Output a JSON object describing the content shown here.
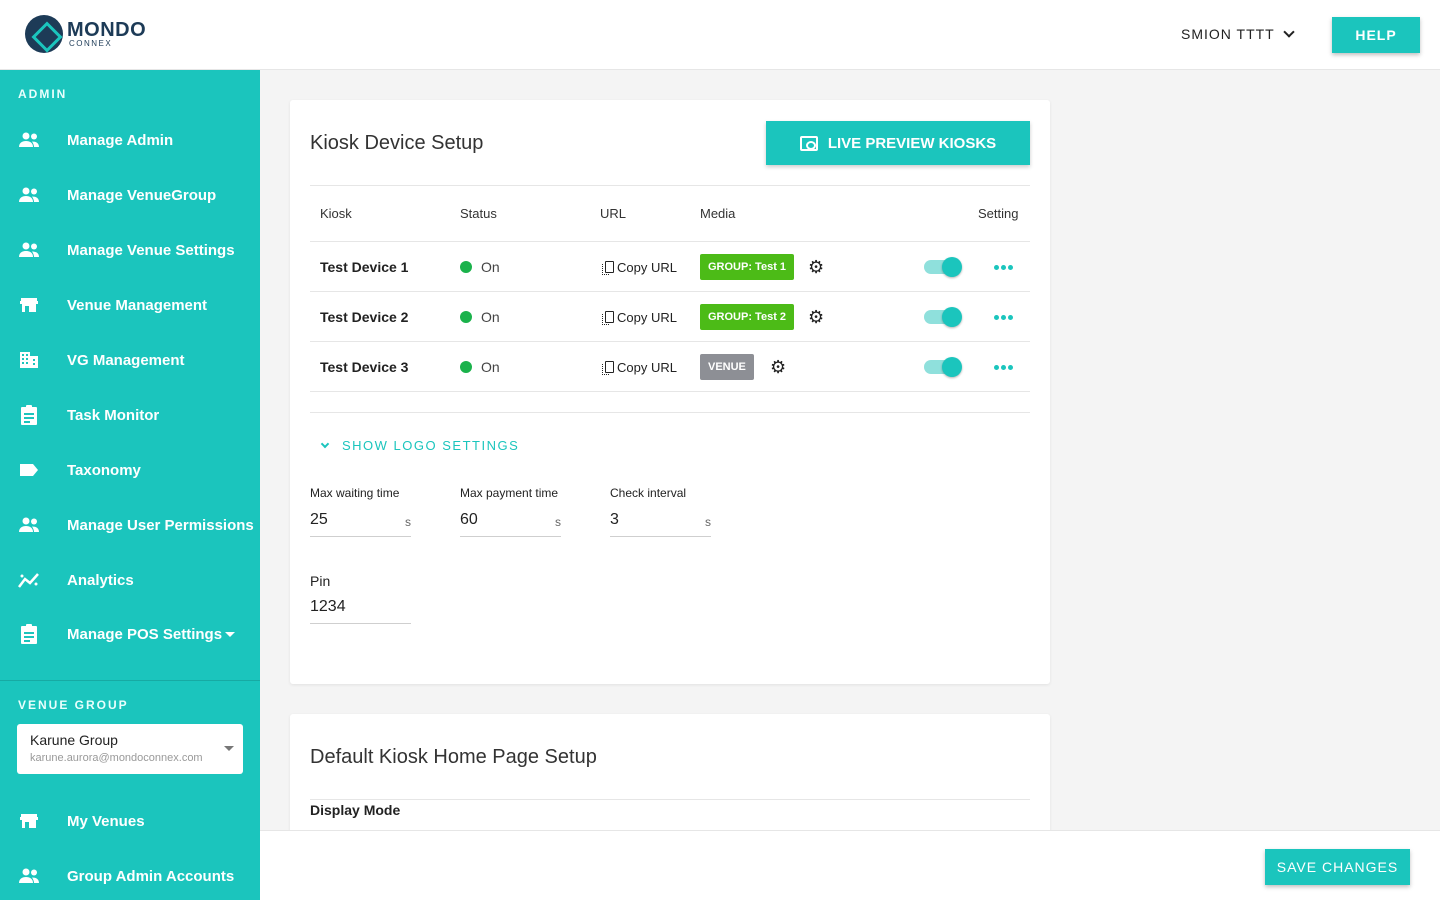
{
  "brand": {
    "name": "MONDO",
    "sub": "CONNEX"
  },
  "header": {
    "user": "SMION TTTT",
    "help_label": "HELP"
  },
  "sidebar": {
    "admin_title": "ADMIN",
    "items": [
      {
        "label": "Manage Admin",
        "icon": "people-icon"
      },
      {
        "label": "Manage VenueGroup",
        "icon": "people-icon"
      },
      {
        "label": "Manage Venue Settings",
        "icon": "people-icon"
      },
      {
        "label": "Venue Management",
        "icon": "store-icon"
      },
      {
        "label": "VG Management",
        "icon": "building-icon"
      },
      {
        "label": "Task Monitor",
        "icon": "clipboard-icon"
      },
      {
        "label": "Taxonomy",
        "icon": "label-icon"
      },
      {
        "label": "Manage User Permissions",
        "icon": "people-icon"
      },
      {
        "label": "Analytics",
        "icon": "analytics-icon"
      },
      {
        "label": "Manage POS Settings",
        "icon": "clipboard-icon"
      }
    ],
    "venue_group_title": "VENUE GROUP",
    "venue_group": {
      "name": "Karune Group",
      "email": "karune.aurora@mondoconnex.com"
    },
    "bottom_items": [
      {
        "label": "My Venues",
        "icon": "store-icon"
      },
      {
        "label": "Group Admin Accounts",
        "icon": "people-icon"
      }
    ]
  },
  "kiosk_setup": {
    "title": "Kiosk Device Setup",
    "preview_label": "LIVE PREVIEW KIOSKS",
    "columns": {
      "kiosk": "Kiosk",
      "status": "Status",
      "url": "URL",
      "media": "Media",
      "setting": "Setting"
    },
    "devices": [
      {
        "name": "Test Device 1",
        "status": "On",
        "url_label": "Copy URL",
        "media": "GROUP: Test 1",
        "enabled": true
      },
      {
        "name": "Test Device 2",
        "status": "On",
        "url_label": "Copy URL",
        "media": "GROUP: Test 2",
        "enabled": true
      },
      {
        "name": "Test Device 3",
        "status": "On",
        "url_label": "Copy URL",
        "media": "VENUE",
        "enabled": true
      }
    ],
    "logo_settings_label": "SHOW LOGO SETTINGS",
    "fields": {
      "max_waiting": {
        "label": "Max waiting time",
        "value": "25",
        "unit": "s"
      },
      "max_payment": {
        "label": "Max payment time",
        "value": "60",
        "unit": "s"
      },
      "check_interval": {
        "label": "Check interval",
        "value": "3",
        "unit": "s"
      },
      "pin": {
        "label": "Pin",
        "value": "1234"
      }
    }
  },
  "home_setup": {
    "title": "Default Kiosk Home Page Setup",
    "display_mode_label": "Display Mode"
  },
  "footer": {
    "save_label": "SAVE CHANGES"
  },
  "colors": {
    "accent": "#1bc5bd",
    "status_on": "#1ab24b",
    "group_tag": "#4cbb17",
    "venue_tag": "#8d8f95"
  }
}
